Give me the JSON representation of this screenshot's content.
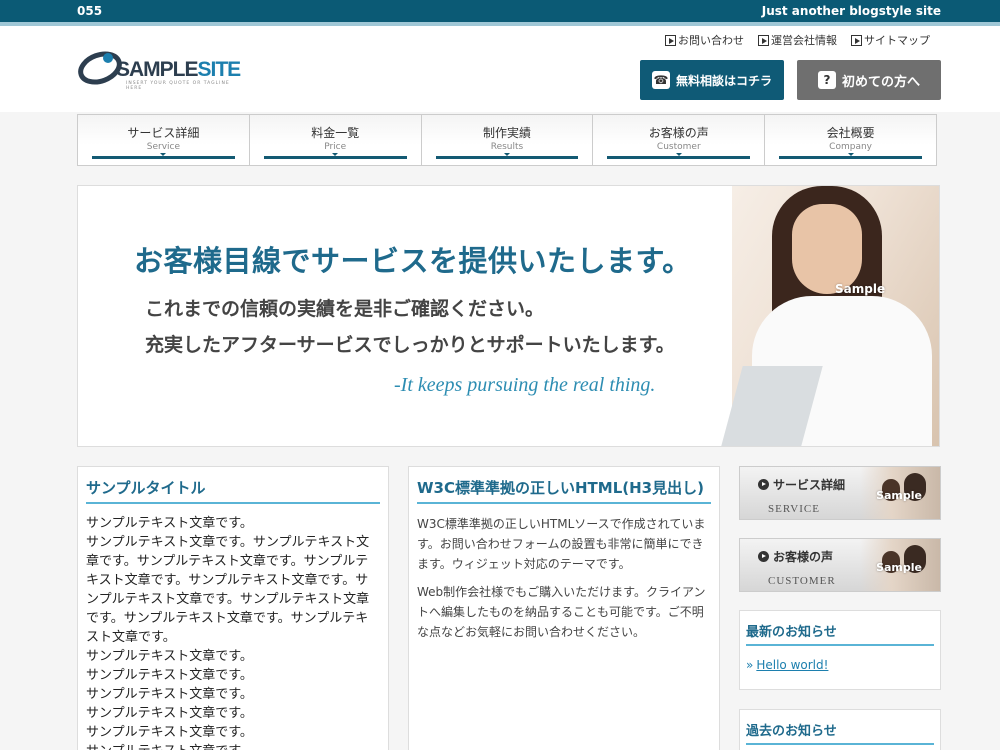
{
  "topbar": {
    "left": "055",
    "right": "Just another blogstyle site"
  },
  "util_links": [
    "お問い合わせ",
    "運営会社情報",
    "サイトマップ"
  ],
  "logo": {
    "name_a": "SAMPLE",
    "name_b": "SITE",
    "tagline": "INSERT YOUR QUOTE OR TAGLINE HERE"
  },
  "header_buttons": {
    "contact": "無料相談はコチラ",
    "first": "初めての方へ"
  },
  "gnav": [
    {
      "jp": "サービス詳細",
      "en": "Service"
    },
    {
      "jp": "料金一覧",
      "en": "Price"
    },
    {
      "jp": "制作実績",
      "en": "Results"
    },
    {
      "jp": "お客様の声",
      "en": "Customer"
    },
    {
      "jp": "会社概要",
      "en": "Company"
    }
  ],
  "hero": {
    "headline": "お客様目線でサービスを提供いたします。",
    "line1": "これまでの信頼の実績を是非ご確認ください。",
    "line2": "充実したアフターサービスでしっかりとサポートいたします。",
    "english": "-It keeps pursuing the real thing.",
    "sample": "Sample"
  },
  "col1": {
    "title": "サンプルタイトル",
    "body": [
      "サンプルテキスト文章です。",
      "サンプルテキスト文章です。サンプルテキスト文章です。サンプルテキスト文章です。サンプルテキスト文章です。サンプルテキスト文章です。サンプルテキスト文章です。サンプルテキスト文章です。サンプルテキスト文章です。サンプルテキスト文章です。",
      "サンプルテキスト文章です。",
      "サンプルテキスト文章です。",
      "サンプルテキスト文章です。",
      "サンプルテキスト文章です。",
      "サンプルテキスト文章です。",
      "サンプルテキスト文章です。"
    ]
  },
  "col2": {
    "title": "W3C標準準拠の正しいHTML(H3見出し)",
    "p1": "W3C標準準拠の正しいHTMLソースで作成されています。お問い合わせフォームの設置も非常に簡単にできます。ウィジェット対応のテーマです。",
    "p2": "Web制作会社様でもご購入いただけます。クライアントへ編集したものを納品することも可能です。ご不明な点などお気軽にお問い合わせください。"
  },
  "sidebar": {
    "banner1": {
      "jp": "サービス詳細",
      "en": "SERVICE",
      "sample": "Sample"
    },
    "banner2": {
      "jp": "お客様の声",
      "en": "CUSTOMER",
      "sample": "Sample"
    },
    "news_title": "最新のお知らせ",
    "news_item": "Hello world!",
    "arrow": "»",
    "past_title": "過去のお知らせ"
  }
}
